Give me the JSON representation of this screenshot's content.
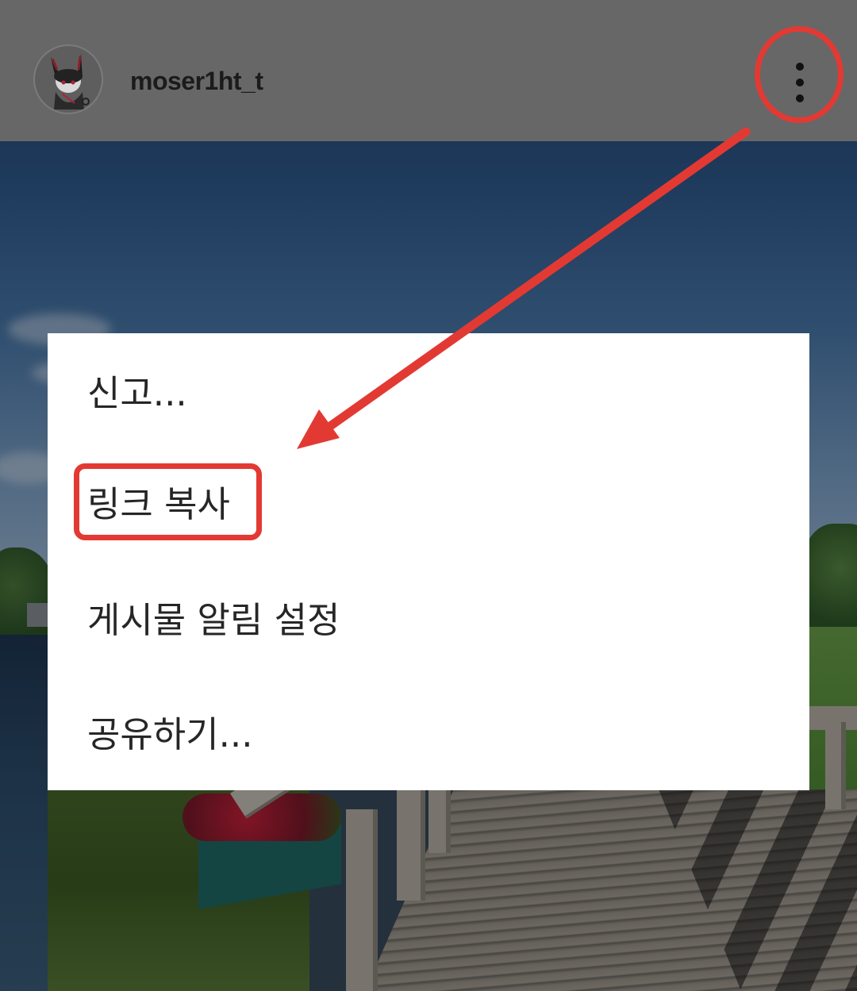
{
  "header": {
    "username": "moser1ht_t",
    "avatar_icon": "character-avatar-icon",
    "more_icon": "more-vertical-icon"
  },
  "menu": {
    "items": [
      {
        "label": "신고..."
      },
      {
        "label": "링크 복사"
      },
      {
        "label": "게시물 알림 설정"
      },
      {
        "label": "공유하기..."
      }
    ]
  },
  "annotations": {
    "color": "#e23a33",
    "circled": "more-options-button",
    "boxed": "링크 복사"
  }
}
